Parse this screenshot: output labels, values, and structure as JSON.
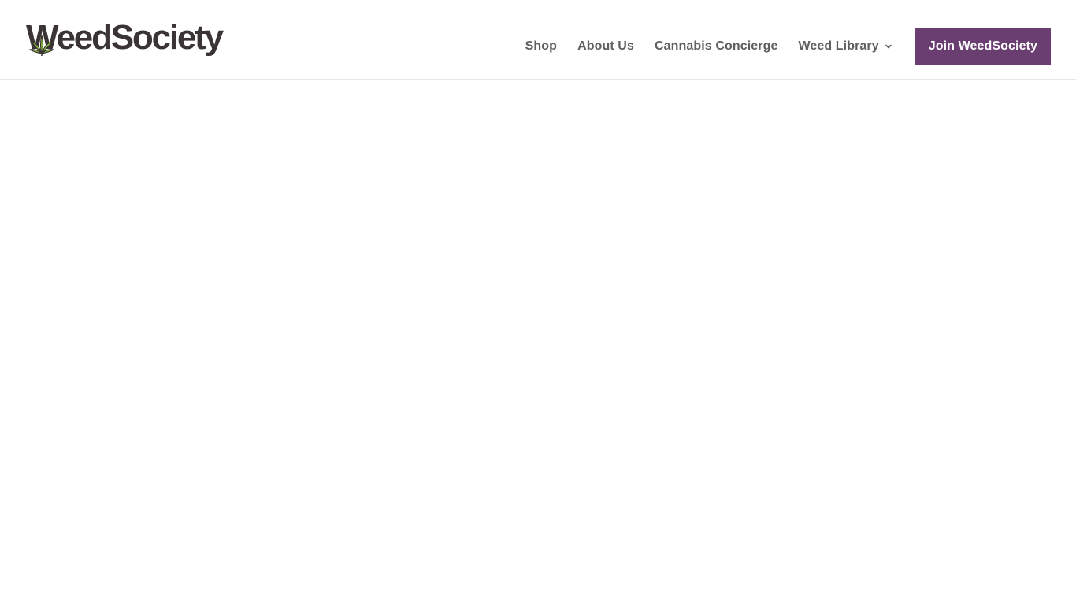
{
  "header": {
    "logo_text": "WeedSociety",
    "nav": [
      {
        "label": "Shop"
      },
      {
        "label": "About Us"
      },
      {
        "label": "Cannabis Concierge"
      },
      {
        "label": "Weed Library"
      }
    ],
    "cta_label": "Join WeedSociety"
  },
  "colors": {
    "brand_purple": "#6b3e72",
    "logo_dark": "#3b3434",
    "leaf_green": "#8cc63f",
    "nav_text": "#5f5f5f"
  },
  "icons": {
    "logo": "cannabis-leaf-icon",
    "dropdown": "chevron-down-icon"
  }
}
